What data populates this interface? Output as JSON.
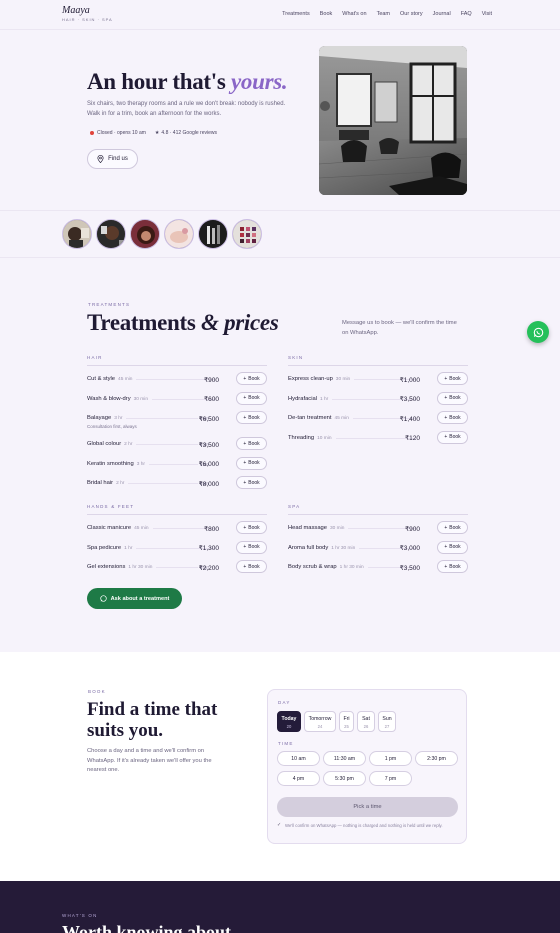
{
  "brand": {
    "name": "Maaya",
    "tagline": "HAIR · SKIN · SPA"
  },
  "nav": {
    "links": [
      "Treatments",
      "Book",
      "What's on",
      "Team",
      "Our story",
      "Journal",
      "FAQ",
      "Visit"
    ]
  },
  "hero": {
    "title_main": "An hour that's",
    "title_accent": "yours.",
    "subtitle": "Six chairs, two therapy rooms and a rule we don't break: nobody is rushed. Walk in for a trim, book an afternoon for the works.",
    "status": "Closed · opens 10 am",
    "rating": "4.8 · 412 Google reviews",
    "find_us": "Find us",
    "status_color": "#e0433b"
  },
  "treatments": {
    "eyebrow": "TREATMENTS",
    "title_main": "Treatments",
    "title_accent": "& prices",
    "note": "Message us to book — we'll confirm the time on WhatsApp.",
    "book_label": "Book",
    "from_label": "from",
    "categories": [
      {
        "name": "HAIR",
        "items": [
          {
            "name": "Cut & style",
            "duration": "45 min",
            "from": false,
            "price": "₹900",
            "note": ""
          },
          {
            "name": "Wash & blow-dry",
            "duration": "30 min",
            "from": false,
            "price": "₹600",
            "note": ""
          },
          {
            "name": "Balayage",
            "duration": "3 hr",
            "from": true,
            "price": "₹6,500",
            "note": "Consultation first, always"
          },
          {
            "name": "Global colour",
            "duration": "2 hr",
            "from": true,
            "price": "₹3,500",
            "note": ""
          },
          {
            "name": "Keratin smoothing",
            "duration": "3 hr",
            "from": true,
            "price": "₹6,000",
            "note": ""
          },
          {
            "name": "Bridal hair",
            "duration": "2 hr",
            "from": true,
            "price": "₹8,000",
            "note": ""
          }
        ]
      },
      {
        "name": "SKIN",
        "items": [
          {
            "name": "Express clean-up",
            "duration": "30 min",
            "from": false,
            "price": "₹1,000",
            "note": ""
          },
          {
            "name": "Hydrafacial",
            "duration": "1 hr",
            "from": false,
            "price": "₹3,500",
            "note": ""
          },
          {
            "name": "De-tan treatment",
            "duration": "45 min",
            "from": false,
            "price": "₹1,400",
            "note": ""
          },
          {
            "name": "Threading",
            "duration": "10 min",
            "from": false,
            "price": "₹120",
            "note": ""
          }
        ]
      },
      {
        "name": "HANDS & FEET",
        "items": [
          {
            "name": "Classic manicure",
            "duration": "45 min",
            "from": false,
            "price": "₹800",
            "note": ""
          },
          {
            "name": "Spa pedicure",
            "duration": "1 hr",
            "from": false,
            "price": "₹1,300",
            "note": ""
          },
          {
            "name": "Gel extensions",
            "duration": "1 hr 30 min",
            "from": true,
            "price": "₹2,200",
            "note": ""
          }
        ]
      },
      {
        "name": "SPA",
        "items": [
          {
            "name": "Head massage",
            "duration": "30 min",
            "from": false,
            "price": "₹900",
            "note": ""
          },
          {
            "name": "Aroma full body",
            "duration": "1 hr 30 min",
            "from": false,
            "price": "₹3,000",
            "note": ""
          },
          {
            "name": "Body scrub & wrap",
            "duration": "1 hr 30 min",
            "from": false,
            "price": "₹3,500",
            "note": ""
          }
        ]
      }
    ],
    "ask_button": "Ask about a treatment",
    "accent_green": "#1e7a46"
  },
  "book": {
    "eyebrow": "BOOK",
    "title": "Find a time that suits you.",
    "subtitle": "Choose a day and a time and we'll confirm on WhatsApp. If it's already taken we'll offer you the nearest one.",
    "day_label": "DAY",
    "days": [
      {
        "name": "Today",
        "date": "20",
        "selected": true
      },
      {
        "name": "Tomorrow",
        "date": "24",
        "selected": false
      },
      {
        "name": "Fri",
        "date": "25",
        "selected": false
      },
      {
        "name": "Sat",
        "date": "26",
        "selected": false
      },
      {
        "name": "Sun",
        "date": "27",
        "selected": false
      }
    ],
    "time_label": "TIME",
    "times": [
      "10 am",
      "11:30 am",
      "1 pm",
      "2:30 pm",
      "4 pm",
      "5:30 pm",
      "7 pm"
    ],
    "pick_button": "Pick a time",
    "fine_print": "We'll confirm on WhatsApp — nothing is charged and nothing is held until we reply."
  },
  "whats_on": {
    "eyebrow": "WHAT'S ON",
    "title": "Worth knowing about"
  }
}
